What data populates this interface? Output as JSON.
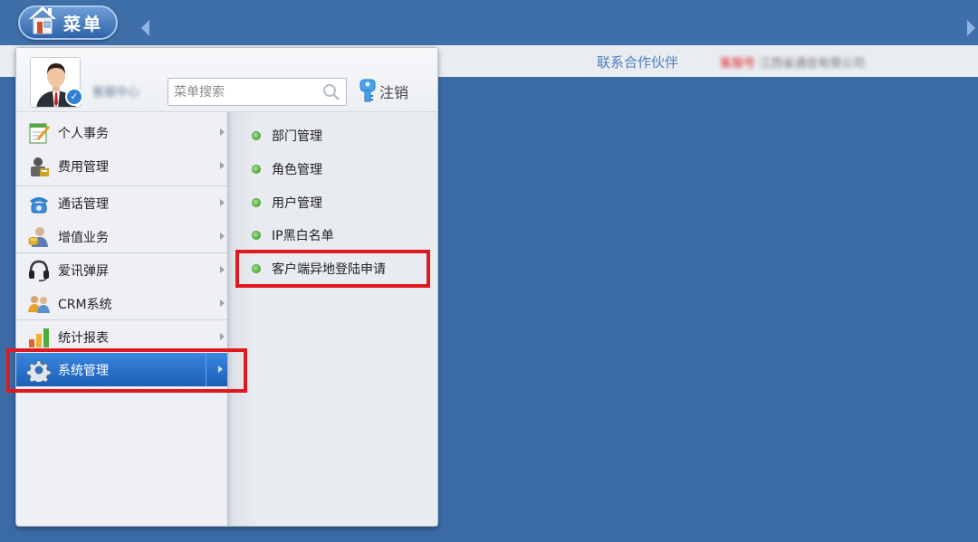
{
  "topbar": {
    "menu_label": "菜单"
  },
  "strip": {
    "partner_link": "联系合作伙伴",
    "company_prefix": "客服号",
    "company_name": "江西省通信有限公司"
  },
  "user": {
    "name": "客服中心"
  },
  "search": {
    "placeholder": "菜单搜索"
  },
  "logout_label": "注销",
  "menu_items": [
    {
      "label": "个人事务",
      "icon": "notepad-icon"
    },
    {
      "label": "费用管理",
      "icon": "cashier-icon"
    },
    {
      "label": "通话管理",
      "icon": "telephone-icon"
    },
    {
      "label": "增值业务",
      "icon": "user-coins-icon"
    },
    {
      "label": "爱讯弹屏",
      "icon": "headset-icon"
    },
    {
      "label": "CRM系统",
      "icon": "users-icon"
    },
    {
      "label": "统计报表",
      "icon": "bar-chart-icon"
    },
    {
      "label": "系统管理",
      "icon": "gear-icon",
      "active": true
    }
  ],
  "submenu_items": [
    {
      "label": "部门管理"
    },
    {
      "label": "角色管理"
    },
    {
      "label": "用户管理"
    },
    {
      "label": "IP黑白名单"
    },
    {
      "label": "客户端异地登陆申请",
      "highlighted": true
    }
  ],
  "colors": {
    "background": "#3b6ba5",
    "highlight": "#e0181f",
    "active_item": "#2a72cc",
    "status_dot": "#4caf3a"
  }
}
